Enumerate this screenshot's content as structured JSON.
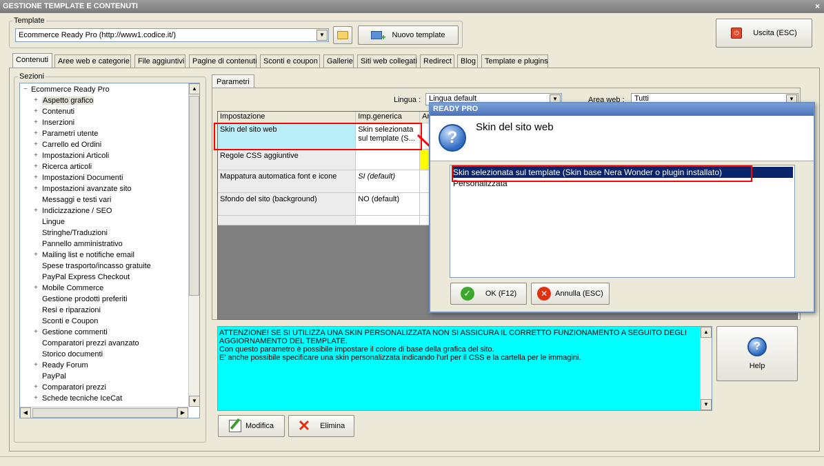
{
  "window": {
    "title": "GESTIONE TEMPLATE E CONTENUTI",
    "close": "×"
  },
  "template": {
    "group_label": "Template",
    "selected": "Ecommerce Ready Pro (http://www1.codice.it/)",
    "new_button": "Nuovo template"
  },
  "exit_button": "Uscita (ESC)",
  "tabs": [
    {
      "label": "Contenuti",
      "active": true
    },
    {
      "label": "Aree web e categorie"
    },
    {
      "label": "File aggiuntivi"
    },
    {
      "label": "Pagine di contenuti"
    },
    {
      "label": "Sconti e coupon"
    },
    {
      "label": "Gallerie"
    },
    {
      "label": "Siti web collegati"
    },
    {
      "label": "Redirect"
    },
    {
      "label": "Blog"
    },
    {
      "label": "Template e plugins"
    }
  ],
  "sections": {
    "label": "Sezioni",
    "root": "Ecommerce Ready Pro",
    "items": [
      {
        "label": "Aspetto grafico",
        "expandable": true,
        "selected": true
      },
      {
        "label": "Contenuti",
        "expandable": true
      },
      {
        "label": "Inserzioni",
        "expandable": true
      },
      {
        "label": "Parametri utente",
        "expandable": true
      },
      {
        "label": "Carrello ed Ordini",
        "expandable": true
      },
      {
        "label": "Impostazioni Articoli",
        "expandable": true
      },
      {
        "label": "Ricerca articoli",
        "expandable": true
      },
      {
        "label": "Impostazioni Documenti",
        "expandable": true
      },
      {
        "label": "Impostazioni avanzate sito",
        "expandable": true
      },
      {
        "label": "Messaggi e testi vari",
        "expandable": false
      },
      {
        "label": "Indicizzazione / SEO",
        "expandable": true
      },
      {
        "label": "Lingue",
        "expandable": false
      },
      {
        "label": "Stringhe/Traduzioni",
        "expandable": false
      },
      {
        "label": "Pannello amministrativo",
        "expandable": false
      },
      {
        "label": "Mailing list e notifiche email",
        "expandable": true
      },
      {
        "label": "Spese trasporto/incasso gratuite",
        "expandable": false
      },
      {
        "label": "PayPal Express Checkout",
        "expandable": false
      },
      {
        "label": "Mobile Commerce",
        "expandable": true
      },
      {
        "label": "Gestione prodotti preferiti",
        "expandable": false
      },
      {
        "label": "Resi e riparazioni",
        "expandable": false
      },
      {
        "label": "Sconti e Coupon",
        "expandable": false
      },
      {
        "label": "Gestione commenti",
        "expandable": true
      },
      {
        "label": "Comparatori prezzi avanzato",
        "expandable": false
      },
      {
        "label": "Storico documenti",
        "expandable": false
      },
      {
        "label": "Ready Forum",
        "expandable": true
      },
      {
        "label": "PayPal",
        "expandable": false
      },
      {
        "label": "Comparatori prezzi",
        "expandable": true
      },
      {
        "label": "Schede tecniche IceCat",
        "expandable": true
      }
    ]
  },
  "params": {
    "tab": "Parametri",
    "lingua_label": "Lingua :",
    "lingua_value": "Lingua default",
    "area_label": "Area web :",
    "area_value": "Tutti",
    "columns": [
      "Impostazione",
      "Imp.generica",
      "Ar"
    ],
    "rows": [
      {
        "name": "Skin del sito web",
        "value": "Skin selezionata sul template (S..."
      },
      {
        "name": "Regole CSS aggiuntive",
        "value": ""
      },
      {
        "name": "Mappatura automatica font e icone",
        "value": "SI (default)"
      },
      {
        "name": "Sfondo del sito (background)",
        "value": "NO (default)"
      }
    ]
  },
  "info_text": {
    "line1": "ATTENZIONE! SE SI UTILIZZA UNA SKIN PERSONALIZZATA NON SI ASSICURA IL CORRETTO FUNZIONAMENTO A SEGUITO DEGLI AGGIORNAMENTO DEL TEMPLATE.",
    "line2": "Con questo parametro è possibile impostare il colore di base della grafica del sito.",
    "line3": "E' anche possibile specificare una skin personalizzata indicando l'url per il CSS e la cartella per le immagini."
  },
  "help_button": "Help",
  "modify_button": "Modifica",
  "delete_button": "Elimina",
  "dialog": {
    "title": "READY PRO",
    "heading": "Skin del sito web",
    "options": [
      "Skin selezionata sul template (Skin base Nera Wonder o plugin installato)",
      "Personalizzata"
    ],
    "ok": "OK (F12)",
    "cancel": "Annulla (ESC)"
  },
  "colors": {
    "highlight": "#0a246a",
    "info_bg": "#00ffff",
    "annotation": "#ff0000",
    "selected_cell": "#b9eef8"
  }
}
